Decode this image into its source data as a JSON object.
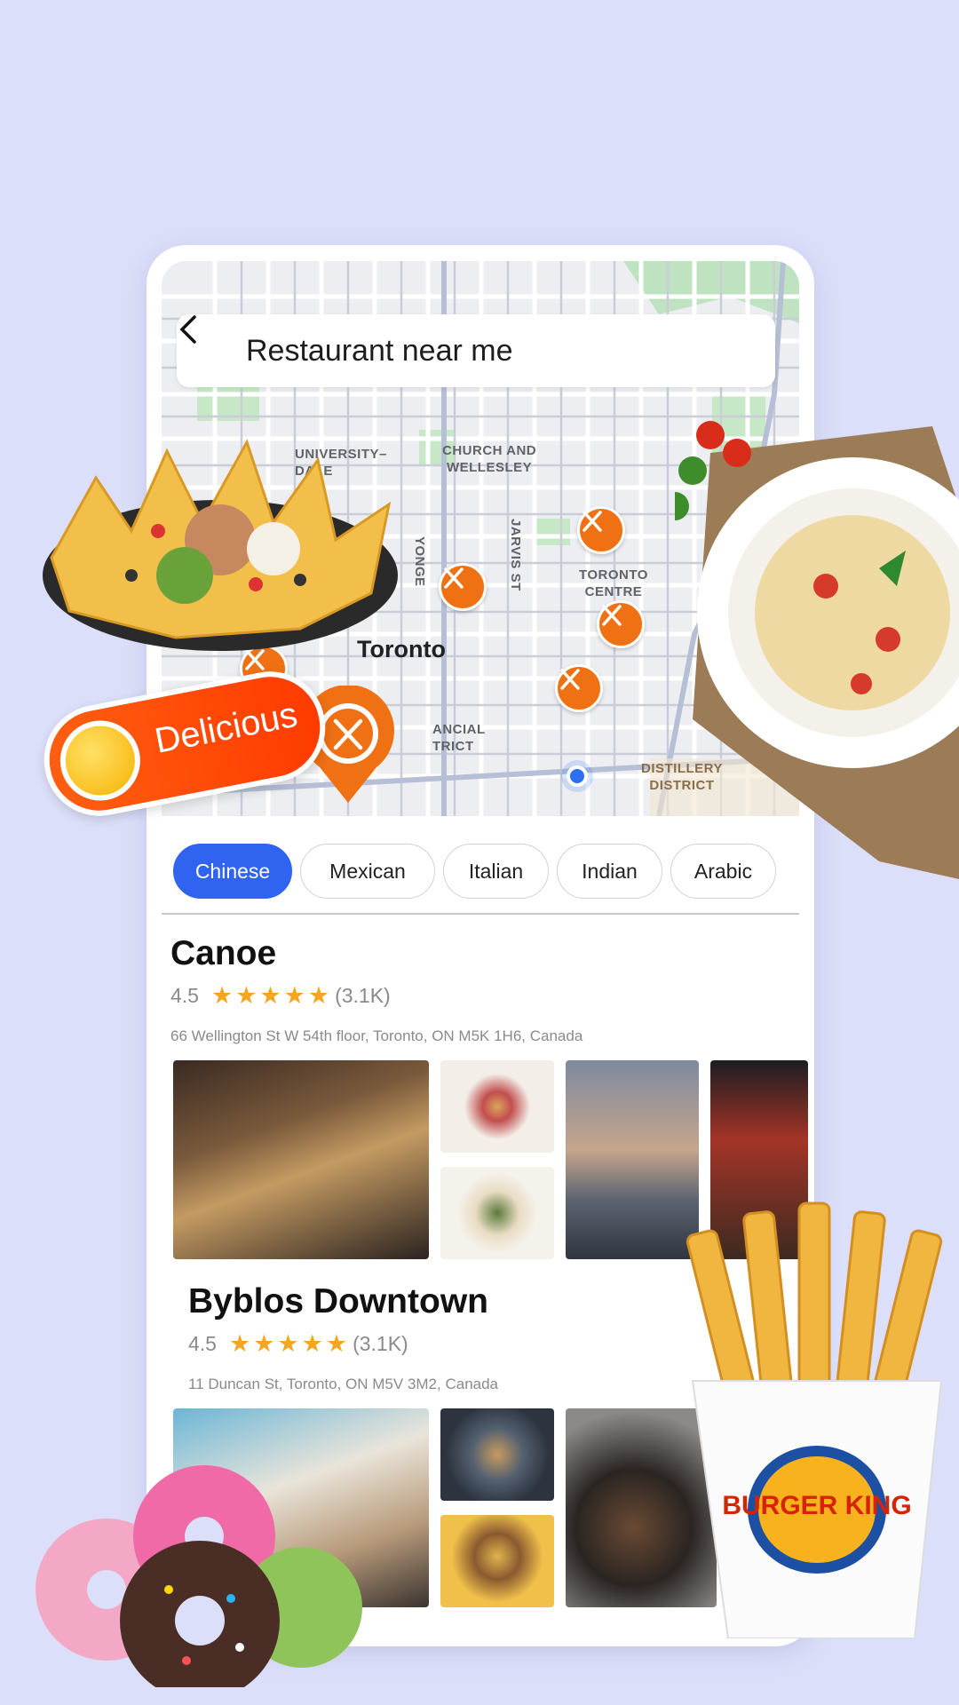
{
  "search": {
    "query": "Restaurant near me"
  },
  "map": {
    "city_label": "Toronto",
    "labels": {
      "university": "UNIVERSITY–\nDALE",
      "church": "CHURCH AND\nWELLESLEY",
      "yonge": "YONGE",
      "jarvis": "JARVIS ST",
      "toronto_centre": "TORONTO\nCENTRE",
      "financial": "ANCIAL\nTRICT",
      "distillery": "DISTILLERY\nDISTRICT"
    }
  },
  "badge": {
    "text": "Delicious"
  },
  "categories": [
    "Chinese",
    "Mexican",
    "Italian",
    "Indian",
    "Arabic"
  ],
  "selected_category": "Chinese",
  "restaurants": [
    {
      "name": "Canoe",
      "rating": "4.5",
      "reviews": "(3.1K)",
      "address": "66 Wellington St W 54th floor, Toronto, ON M5K 1H6, Canada"
    },
    {
      "name": "Byblos Downtown",
      "rating": "4.5",
      "reviews": "(3.1K)",
      "address": "11 Duncan St, Toronto, ON M5V 3M2, Canada"
    }
  ],
  "brand": {
    "fries_logo": "BURGER KING"
  },
  "colors": {
    "accent": "#2f63f0",
    "pin": "#f07114",
    "star": "#f4a623",
    "background": "#dcdff9"
  }
}
